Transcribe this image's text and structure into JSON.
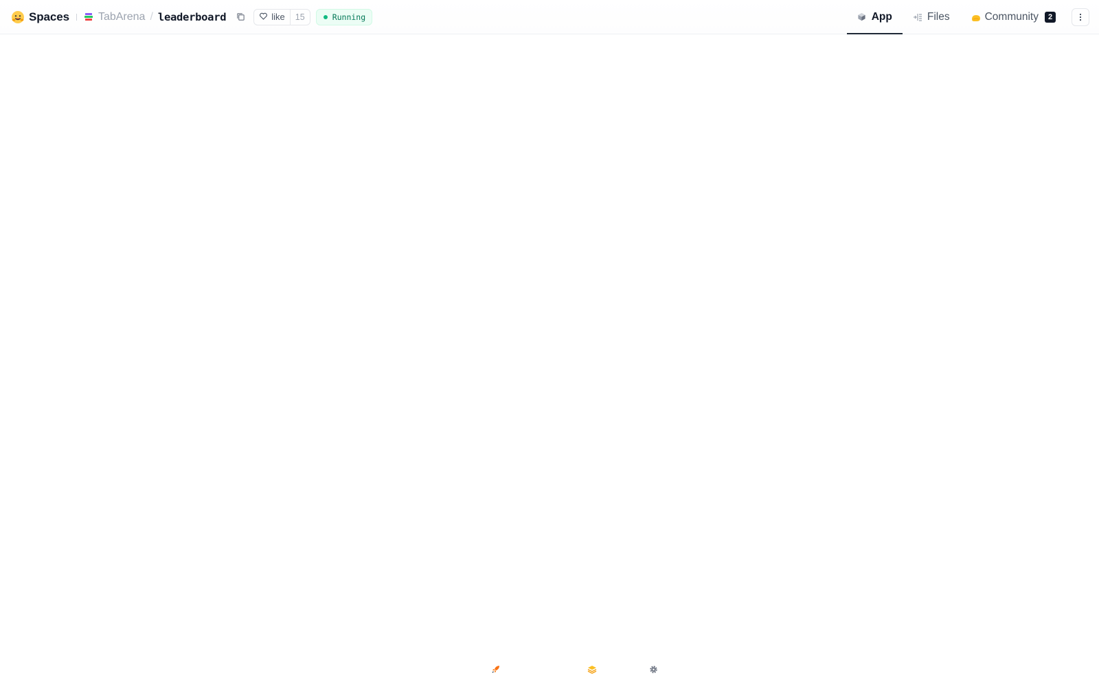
{
  "header": {
    "brand": {
      "label": "Spaces",
      "icon": "hugging-face-icon"
    },
    "repo": {
      "org": "TabArena",
      "separator": "/",
      "name": "leaderboard",
      "copy_icon": "copy-icon"
    },
    "like": {
      "label": "like",
      "count": "15",
      "icon": "heart-icon"
    },
    "status": {
      "label": "Running",
      "color": "#10b981"
    },
    "tabs": [
      {
        "label": "App",
        "icon": "cube-icon",
        "active": true
      },
      {
        "label": "Files",
        "icon": "files-icon",
        "active": false
      },
      {
        "label": "Community",
        "icon": "community-icon",
        "active": false,
        "badge": "2"
      }
    ],
    "more_icon": "kebab-menu-icon"
  },
  "footer": {
    "icons": [
      "rocket-icon",
      "stack-icon",
      "settings-gear-icon"
    ]
  },
  "colors": {
    "accent_dark": "#1f2937",
    "running_green": "#10b981",
    "hf_yellow": "#ffcc4d"
  }
}
